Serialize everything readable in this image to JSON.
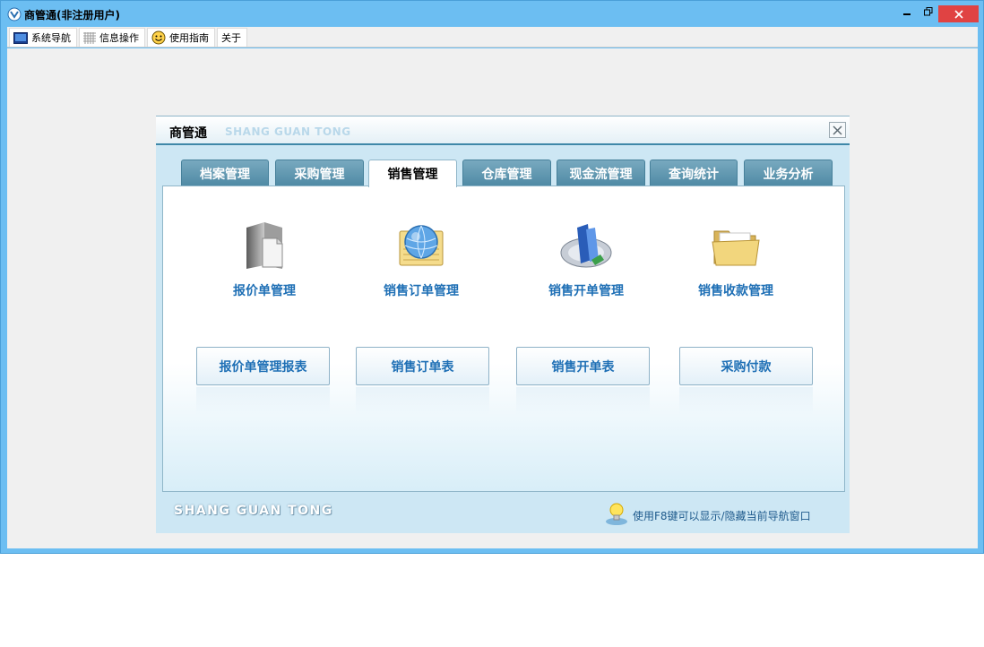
{
  "window": {
    "title": "商管通(非注册用户)"
  },
  "menubar": {
    "items": [
      {
        "label": "系统导航",
        "icon": "monitor-icon"
      },
      {
        "label": "信息操作",
        "icon": "grid-icon"
      },
      {
        "label": "使用指南",
        "icon": "smiley-icon"
      },
      {
        "label": "关于",
        "icon": ""
      }
    ]
  },
  "panel": {
    "title": "商管通",
    "subtitle": "SHANG GUAN TONG",
    "tabs": [
      {
        "label": "档案管理",
        "active": false
      },
      {
        "label": "采购管理",
        "active": false
      },
      {
        "label": "销售管理",
        "active": true
      },
      {
        "label": "仓库管理",
        "active": false
      },
      {
        "label": "现金流管理",
        "active": false
      },
      {
        "label": "查询统计",
        "active": false
      },
      {
        "label": "业务分析",
        "active": false
      }
    ],
    "modules": [
      {
        "label": "报价单管理",
        "icon": "quote-document-icon"
      },
      {
        "label": "销售订单管理",
        "icon": "globe-notepad-icon"
      },
      {
        "label": "销售开单管理",
        "icon": "books-disc-icon"
      },
      {
        "label": "销售收款管理",
        "icon": "folder-icon"
      }
    ],
    "report_buttons": [
      {
        "label": "报价单管理报表"
      },
      {
        "label": "销售订单表"
      },
      {
        "label": "销售开单表"
      },
      {
        "label": "采购付款"
      }
    ],
    "footer": {
      "brand": "SHANG GUAN TONG",
      "tip": "使用F8键可以显示/隐藏当前导航窗口",
      "tip_icon": "lightbulb-icon"
    }
  },
  "colors": {
    "titlebar": "#6cbef2",
    "close_button": "#e04343",
    "tab_inactive": "#5b93ad",
    "accent_text": "#1e6fb5"
  }
}
